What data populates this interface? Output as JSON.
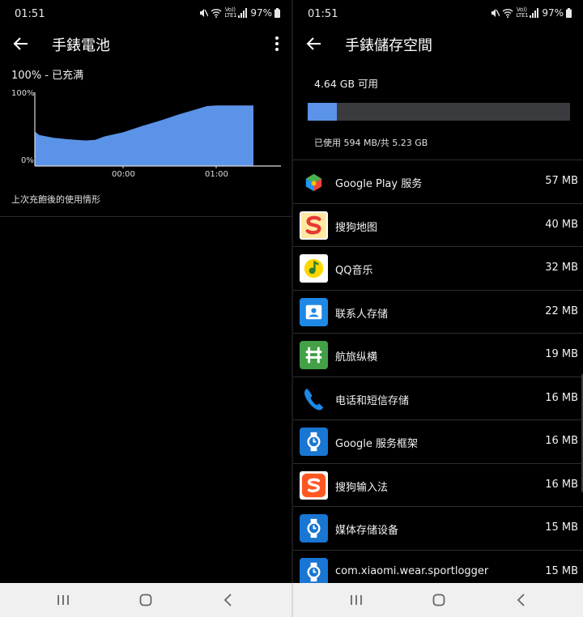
{
  "status_bar": {
    "time": "01:51",
    "volte_line1": "Vo))",
    "volte_line2": "LTE1",
    "battery": "97%",
    "icons": [
      "mute-icon",
      "wifi-icon",
      "volte-icon",
      "signal-icon",
      "battery-icon"
    ]
  },
  "battery_screen": {
    "title": "手錶電池",
    "battery_level": "100% - 已充满",
    "y_max_label": "100%",
    "y_min_label": "0%",
    "x_labels": [
      "00:00",
      "01:00"
    ],
    "usage_note": "上次充飽後的使用情形",
    "chart_color": "#5b93e8"
  },
  "chart_data": {
    "type": "area",
    "title": "",
    "xlabel": "",
    "ylabel": "",
    "x_tick_labels": [
      "00:00",
      "01:00"
    ],
    "ylim": [
      0,
      100
    ],
    "y_tick_labels": [
      "0%",
      "100%"
    ],
    "x": [
      -1.0,
      -0.9,
      -0.75,
      -0.6,
      -0.5,
      -0.4,
      -0.3,
      -0.2,
      0.0,
      0.2,
      0.4,
      0.6,
      0.8,
      0.9,
      1.0,
      1.4
    ],
    "values": [
      50,
      45,
      41,
      39,
      38,
      37,
      38,
      43,
      49,
      58,
      66,
      75,
      83,
      87,
      88,
      88
    ],
    "color": "#5b93e8"
  },
  "storage_screen": {
    "title": "手錶儲存空間",
    "free": "4.64 GB 可用",
    "used_summary": "已使用 594 MB/共 5.23 GB",
    "used_fraction": 0.111,
    "bar_fill_color": "#5b93e8",
    "bar_track_color": "#3a3b3e",
    "apps": [
      {
        "name": "Google Play 服务",
        "size": "57 MB",
        "icon": "google-play-services-icon"
      },
      {
        "name": "搜狗地图",
        "size": "40 MB",
        "icon": "sogou-map-icon"
      },
      {
        "name": "QQ音乐",
        "size": "32 MB",
        "icon": "qq-music-icon"
      },
      {
        "name": "联系人存储",
        "size": "22 MB",
        "icon": "contacts-storage-icon"
      },
      {
        "name": "航旅纵横",
        "size": "19 MB",
        "icon": "hanglv-icon"
      },
      {
        "name": "电话和短信存储",
        "size": "16 MB",
        "icon": "phone-icon"
      },
      {
        "name": "Google 服务框架",
        "size": "16 MB",
        "icon": "wear-os-icon"
      },
      {
        "name": "搜狗输入法",
        "size": "16 MB",
        "icon": "sogou-input-icon"
      },
      {
        "name": "媒体存储设备",
        "size": "15 MB",
        "icon": "wear-os-icon"
      },
      {
        "name": "com.xiaomi.wear.sportlogger",
        "size": "15 MB",
        "icon": "wear-os-icon"
      }
    ]
  },
  "nav_bar": {
    "buttons": [
      "recents-icon",
      "home-icon",
      "back-icon"
    ]
  }
}
